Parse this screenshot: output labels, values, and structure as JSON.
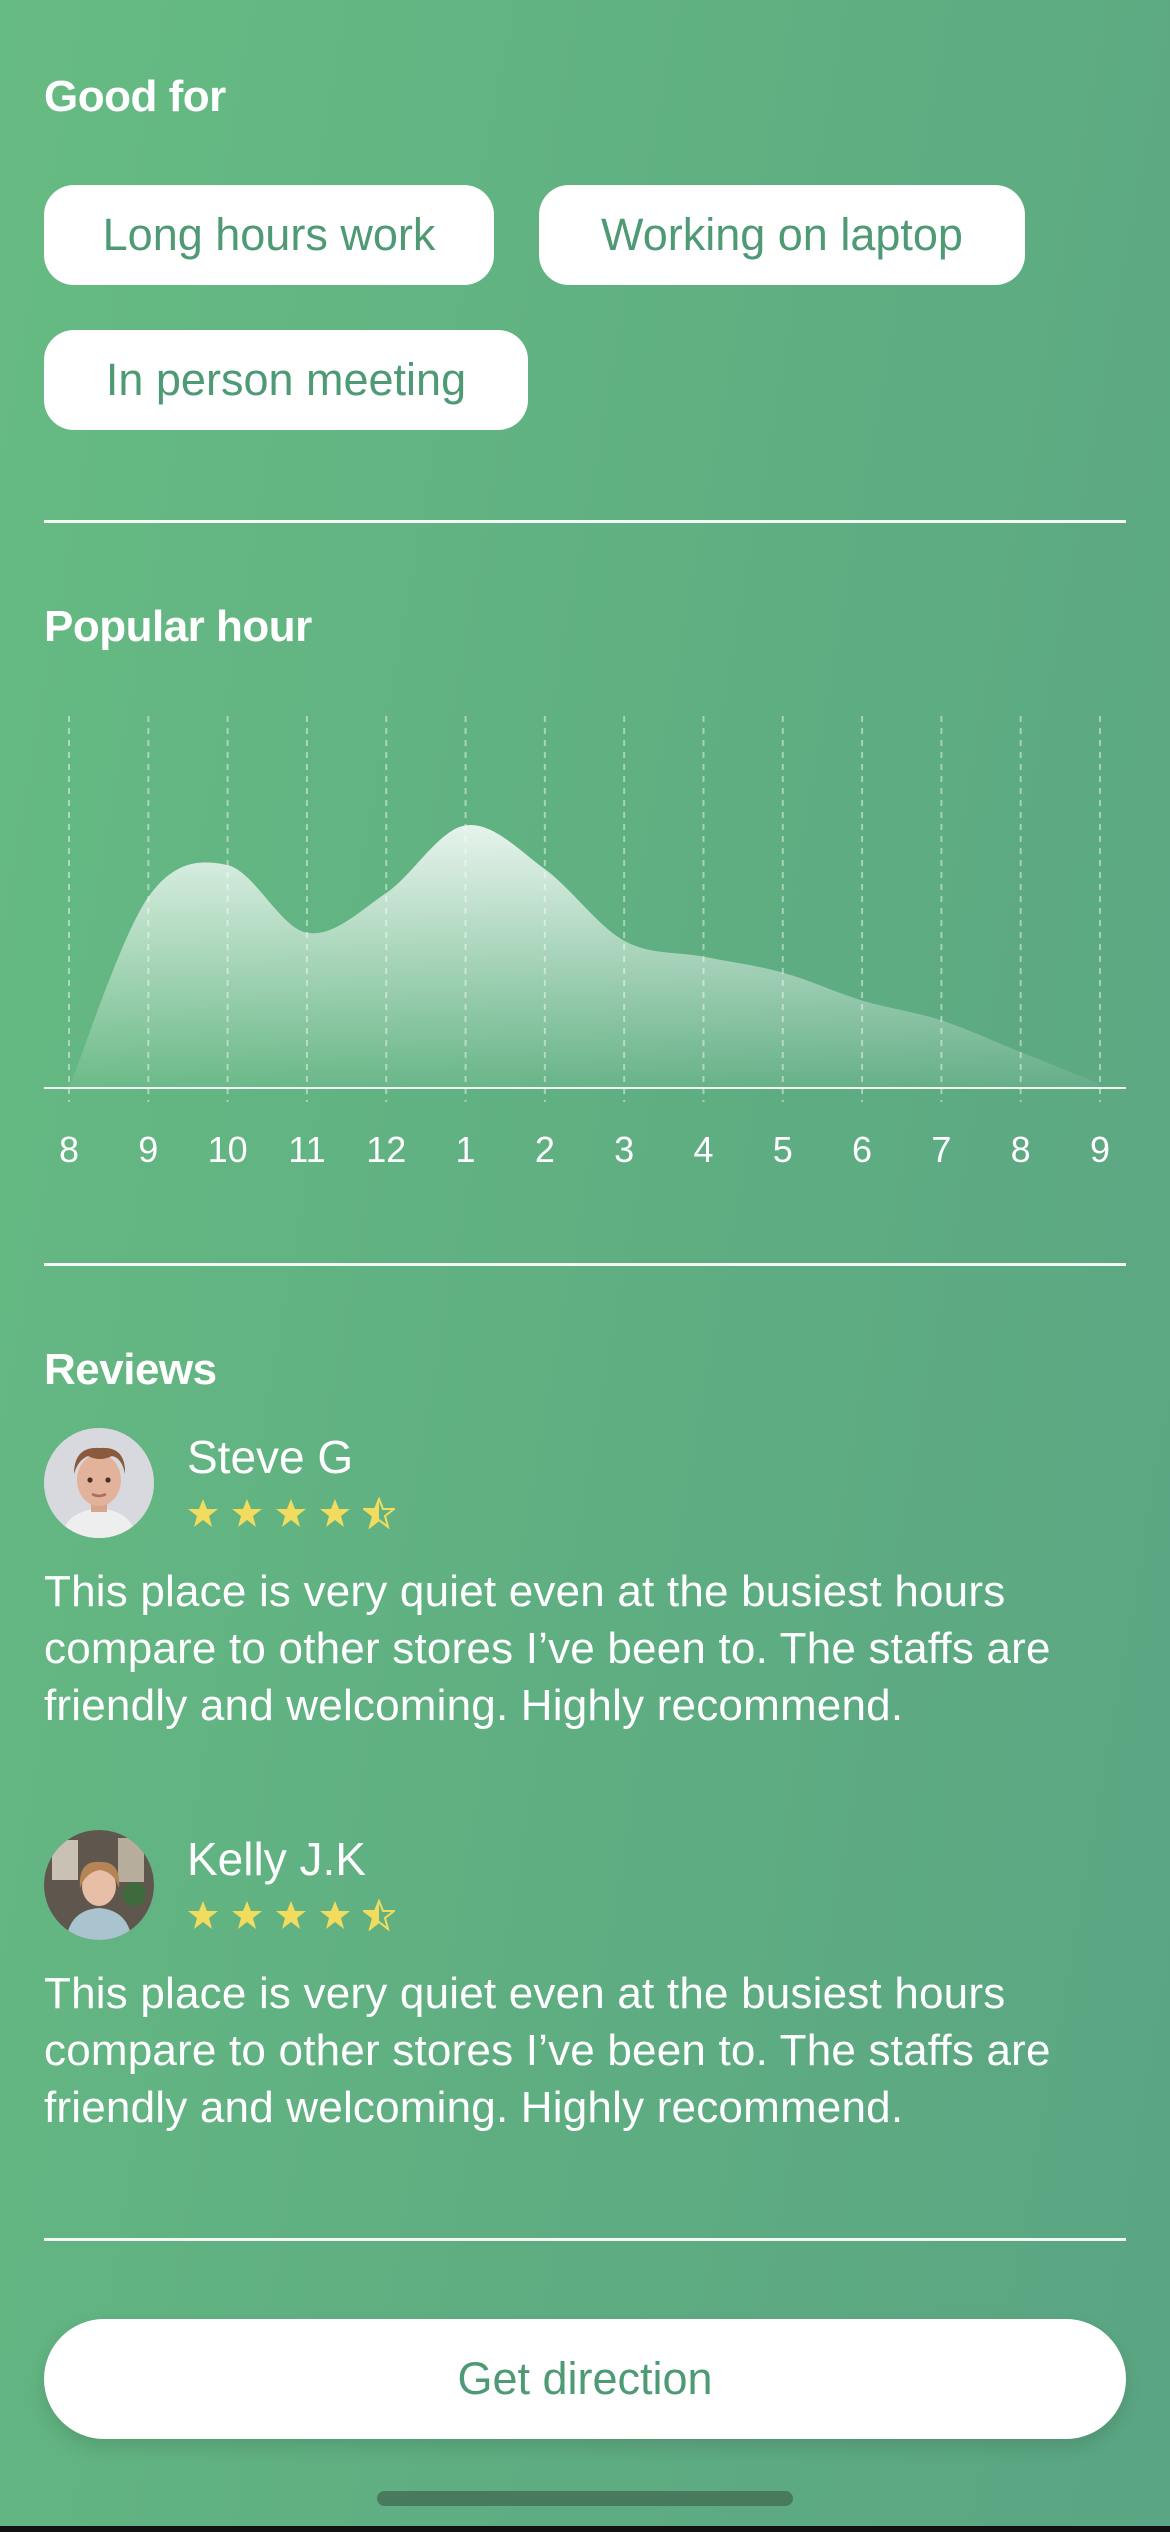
{
  "good_for": {
    "title": "Good for",
    "tags": [
      "Long hours work",
      "Working on laptop",
      "In person meeting"
    ]
  },
  "popular_hour": {
    "title": "Popular hour"
  },
  "chart_data": {
    "type": "area",
    "title": "Popular hour",
    "xlabel": "",
    "ylabel": "",
    "categories": [
      "8",
      "9",
      "10",
      "11",
      "12",
      "1",
      "2",
      "3",
      "4",
      "5",
      "6",
      "7",
      "8",
      "9"
    ],
    "values": [
      0,
      48,
      56,
      39,
      49,
      66,
      55,
      37,
      33,
      29,
      22,
      17,
      9,
      1
    ],
    "ylim": [
      0,
      100
    ],
    "grid": "vertical dashed lines at each hour",
    "colors": {
      "fill_top": "#ffffff",
      "fill_bottom": "#66bb82",
      "grid": "#ffffff"
    }
  },
  "reviews": {
    "title": "Reviews",
    "items": [
      {
        "name": "Steve G",
        "rating": 4.5,
        "text": "This place is very quiet even at the busiest hours compare to other stores I’ve been to. The staffs are friendly and welcoming. Highly recommend."
      },
      {
        "name": "Kelly J.K",
        "rating": 4.5,
        "text": "This place is very quiet even at the busiest hours compare to other stores I’ve been to. The staffs are friendly and welcoming. Highly recommend."
      }
    ]
  },
  "actions": {
    "get_direction": "Get direction"
  },
  "colors": {
    "accent": "#4e9a74",
    "star": "#f2dc5d",
    "background": "#62b283"
  }
}
